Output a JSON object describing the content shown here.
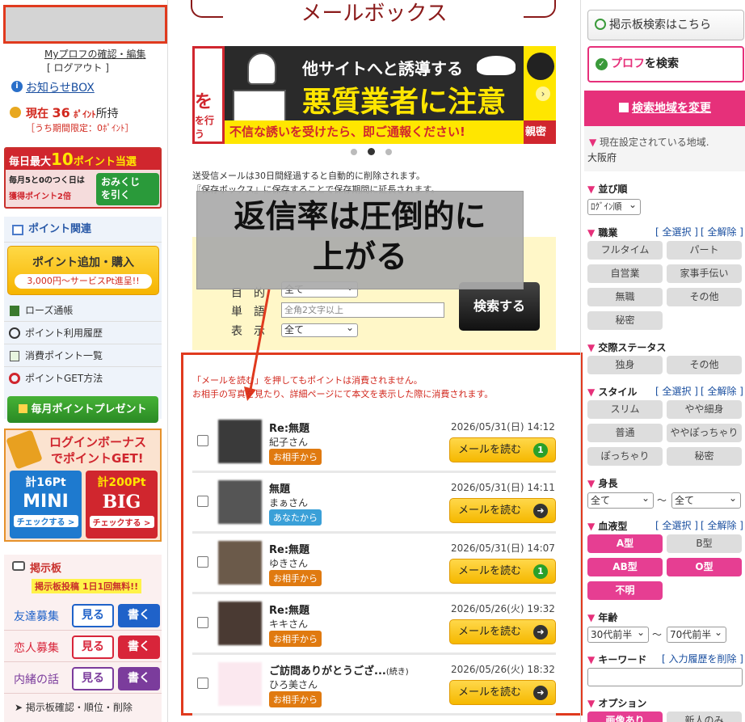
{
  "left": {
    "prof_edit": "Myプロフの確認・編集",
    "logout": "[ ログアウト ]",
    "notice": "お知らせBOX",
    "points_prefix": "現在",
    "points_value": "36",
    "points_unit": "ﾎﾟｲﾝﾄ",
    "points_suffix": "所持",
    "points_limited": "［うち期間限定：0ﾎﾟｲﾝﾄ］",
    "banner_line1a": "毎日最大",
    "banner_line1b": "10",
    "banner_line1c": "ポイント当選",
    "banner_line2": "毎月5と0のつく日は",
    "banner_line3": "獲得ポイント2倍",
    "banner_omikuji": "おみくじを引く",
    "point_header": "ポイント関連",
    "buy_main": "ポイント追加・購入",
    "buy_sub": "3,000円〜サービスPt進呈!!",
    "links": [
      "ローズ通帳",
      "ポイント利用履歴",
      "消費ポイント一覧",
      "ポイントGET方法"
    ],
    "monthly": "毎月ポイントプレゼント",
    "login_bonus_a": "ログインボーナス",
    "login_bonus_b": "でポイントGET!",
    "mini_pt": "計16Pt",
    "mini": "MINI",
    "mini_check": "チェックする >",
    "big_pt": "計200Pt",
    "big": "BIG",
    "big_check": "チェックする >",
    "board_header": "掲示板",
    "board_free": "掲示板投稿 1日1回無料!!",
    "board_rows": [
      {
        "label": "友達募集",
        "view": "見る",
        "write": "書く",
        "color": "#1f62c9"
      },
      {
        "label": "恋人募集",
        "view": "見る",
        "write": "書く",
        "color": "#d8253a"
      },
      {
        "label": "内緒の話",
        "view": "見る",
        "write": "書く",
        "color": "#7b3c9c"
      }
    ],
    "board_confirm": "掲示板確認・順位・削除"
  },
  "center": {
    "title": "メールボックス",
    "ad_title": "他サイトへと誘導する",
    "ad_main": "悪質業者に注意",
    "ad_bottom": "不信な誘いを受けたら、即ご通報ください!",
    "ad_left_a": "を",
    "ad_left_b": "を行う",
    "ad_right": "親密",
    "note1": "送受信メールは30日間経過すると自動的に削除されます。",
    "note2": "『保存ボックス』に保存することで保存期間に延長されます。",
    "overlay_line1": "返信率は圧倒的に",
    "overlay_line2": "上がる",
    "search": {
      "label_word": "単　語",
      "label_disp": "表　示",
      "label_top": "目　的",
      "word_placeholder": "全角2文字以上",
      "disp_value": "全て",
      "top_value": "全て",
      "button": "検索する"
    },
    "info1": "「メールを読む」を押してもポイントは消費されません。",
    "info2": "お相手の写真を見たり、詳細ページにて本文を表示した際に消費されます。",
    "mails": [
      {
        "subject": "Re:無題",
        "subject_small": "",
        "name": "紀子さん",
        "tag": "お相手から",
        "tag_color": "#e07a10",
        "date": "2026/05/31(日) 14:12",
        "button": "メールを読む",
        "badge": "1",
        "badge_color": "#2aa02a"
      },
      {
        "subject": "無題",
        "subject_small": "",
        "name": "まぁさん",
        "tag": "あなたから",
        "tag_color": "#3aa0d8",
        "date": "2026/05/31(日) 14:11",
        "button": "メールを読む",
        "badge": "➜",
        "badge_color": "#333"
      },
      {
        "subject": "Re:無題",
        "subject_small": "",
        "name": "ゆきさん",
        "tag": "お相手から",
        "tag_color": "#e07a10",
        "date": "2026/05/31(日) 14:07",
        "button": "メールを読む",
        "badge": "1",
        "badge_color": "#2aa02a"
      },
      {
        "subject": "Re:無題",
        "subject_small": "",
        "name": "キキさん",
        "tag": "お相手から",
        "tag_color": "#e07a10",
        "date": "2026/05/26(火) 19:32",
        "button": "メールを読む",
        "badge": "➜",
        "badge_color": "#333"
      },
      {
        "subject": "ご訪問ありがとうござ...",
        "subject_small": "(続き)",
        "name": "ひろ美さん",
        "tag": "お相手から",
        "tag_color": "#e07a10",
        "date": "2026/05/26(火) 18:32",
        "button": "メールを読む",
        "badge": "➜",
        "badge_color": "#333"
      }
    ]
  },
  "right": {
    "board_search": "掲示板検索はこちら",
    "prof_search": "プロフを検索",
    "prof_search_a": "プロフ",
    "prof_search_b": "を検索",
    "region_button": "検索地域を変更",
    "region_label": "現在設定されている地域.",
    "region_value": "大阪府",
    "sort_label": "並び順",
    "sort_value": "ﾛｸﾞｲﾝ順",
    "select_all": "[ 全選択 ]",
    "clear_all": "[ 全解除 ]",
    "job_label": "職業",
    "jobs": [
      "フルタイム",
      "パート",
      "自営業",
      "家事手伝い",
      "無職",
      "その他",
      "秘密"
    ],
    "status_label": "交際ステータス",
    "statuses": [
      "独身",
      "その他"
    ],
    "style_label": "スタイル",
    "styles": [
      "スリム",
      "やや細身",
      "普通",
      "ややぽっちゃり",
      "ぽっちゃり",
      "秘密"
    ],
    "height_label": "身長",
    "height_from": "全て",
    "height_to": "全て",
    "tilde": "〜",
    "blood_label": "血液型",
    "bloods": [
      "A型",
      "B型",
      "AB型",
      "O型",
      "不明"
    ],
    "age_label": "年齢",
    "age_from": "30代前半",
    "age_to": "70代前半",
    "keyword_label": "キーワード",
    "keyword_history": "[ 入力履歴を削除 ]",
    "option_label": "オプション",
    "options": [
      "画像あり",
      "新人のみ"
    ]
  }
}
